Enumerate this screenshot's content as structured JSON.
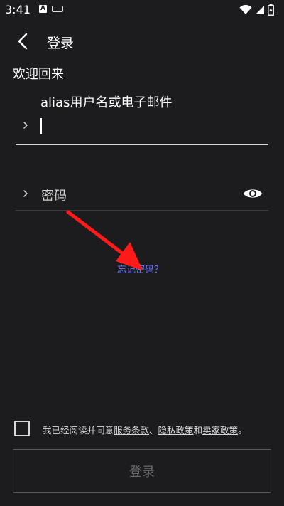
{
  "status_bar": {
    "time": "3:41",
    "notification_letter": "A",
    "icons": [
      "keyboard-icon",
      "wifi-icon",
      "signal-icon",
      "battery-icon"
    ]
  },
  "header": {
    "title": "登录",
    "back_icon": "chevron-left-icon"
  },
  "welcome_text": "欢迎回来",
  "username": {
    "label": "alias用户名或电子邮件",
    "value": ""
  },
  "password": {
    "placeholder": "密码",
    "visibility_icon": "eye-icon"
  },
  "forgot_password": "忘记密码？",
  "agreement": {
    "prefix": "我已经阅读并同意",
    "terms": "服务条款",
    "sep1": "、",
    "privacy": "隐私政策",
    "and": "和",
    "seller": "卖家政策",
    "suffix": "。"
  },
  "login_button": "登录",
  "colors": {
    "background": "#1c1c1e",
    "link": "#6d75ff",
    "annotation_arrow": "#ff1a1a"
  }
}
